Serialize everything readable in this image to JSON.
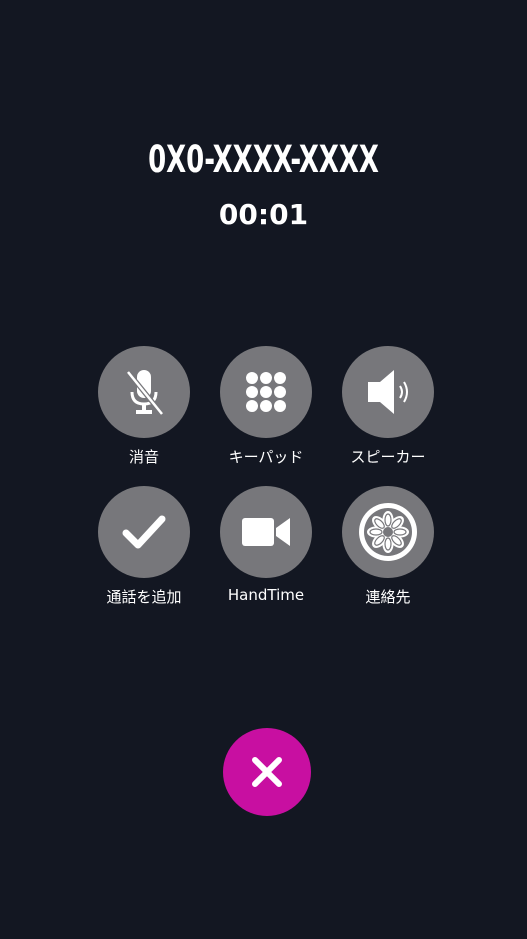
{
  "call": {
    "number": "0X0-XXXX-XXXX",
    "duration": "00:01"
  },
  "controls": [
    {
      "label": "消音",
      "icon": "mic-off-icon"
    },
    {
      "label": "キーパッド",
      "icon": "keypad-icon"
    },
    {
      "label": "スピーカー",
      "icon": "speaker-icon"
    },
    {
      "label": "通話を追加",
      "icon": "checkmark-icon"
    },
    {
      "label": "HandTime",
      "icon": "video-camera-icon"
    },
    {
      "label": "連絡先",
      "icon": "contacts-flower-icon"
    }
  ],
  "colors": {
    "background": "#131722",
    "button": "#77777b",
    "end_call": "#c80fa1"
  },
  "end_call": {
    "icon": "close-icon"
  }
}
